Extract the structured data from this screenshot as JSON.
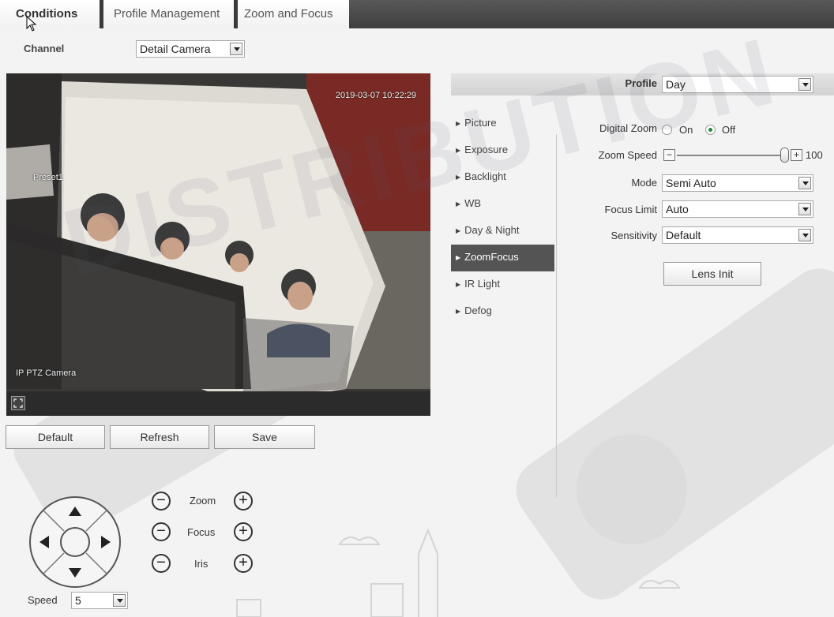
{
  "watermark": "DISTRIBUTION",
  "tabs": [
    {
      "label": "Conditions"
    },
    {
      "label": "Profile Management"
    },
    {
      "label": "Zoom and Focus"
    }
  ],
  "channel": {
    "label": "Channel",
    "value": "Detail Camera"
  },
  "video": {
    "timestamp": "2019-03-07 10:22:29",
    "preset_label": "Preset1",
    "camera_name": "IP PTZ Camera"
  },
  "actions": {
    "default": "Default",
    "refresh": "Refresh",
    "save": "Save"
  },
  "ptz": {
    "zoom_label": "Zoom",
    "focus_label": "Focus",
    "iris_label": "Iris",
    "speed_label": "Speed",
    "speed_value": "5"
  },
  "profile": {
    "label": "Profile",
    "value": "Day"
  },
  "menu": [
    {
      "label": "Picture"
    },
    {
      "label": "Exposure"
    },
    {
      "label": "Backlight"
    },
    {
      "label": "WB"
    },
    {
      "label": "Day & Night"
    },
    {
      "label": "ZoomFocus"
    },
    {
      "label": "IR Light"
    },
    {
      "label": "Defog"
    }
  ],
  "zoomfocus": {
    "digital_zoom_label": "Digital Zoom",
    "on_label": "On",
    "off_label": "Off",
    "zoom_speed_label": "Zoom Speed",
    "zoom_speed_value": "100",
    "mode_label": "Mode",
    "mode_value": "Semi Auto",
    "focus_limit_label": "Focus Limit",
    "focus_limit_value": "Auto",
    "sensitivity_label": "Sensitivity",
    "sensitivity_value": "Default",
    "lens_init": "Lens Init"
  },
  "colors": {
    "accent_dark": "#545454",
    "radio_checked": "#1f8c3a"
  }
}
